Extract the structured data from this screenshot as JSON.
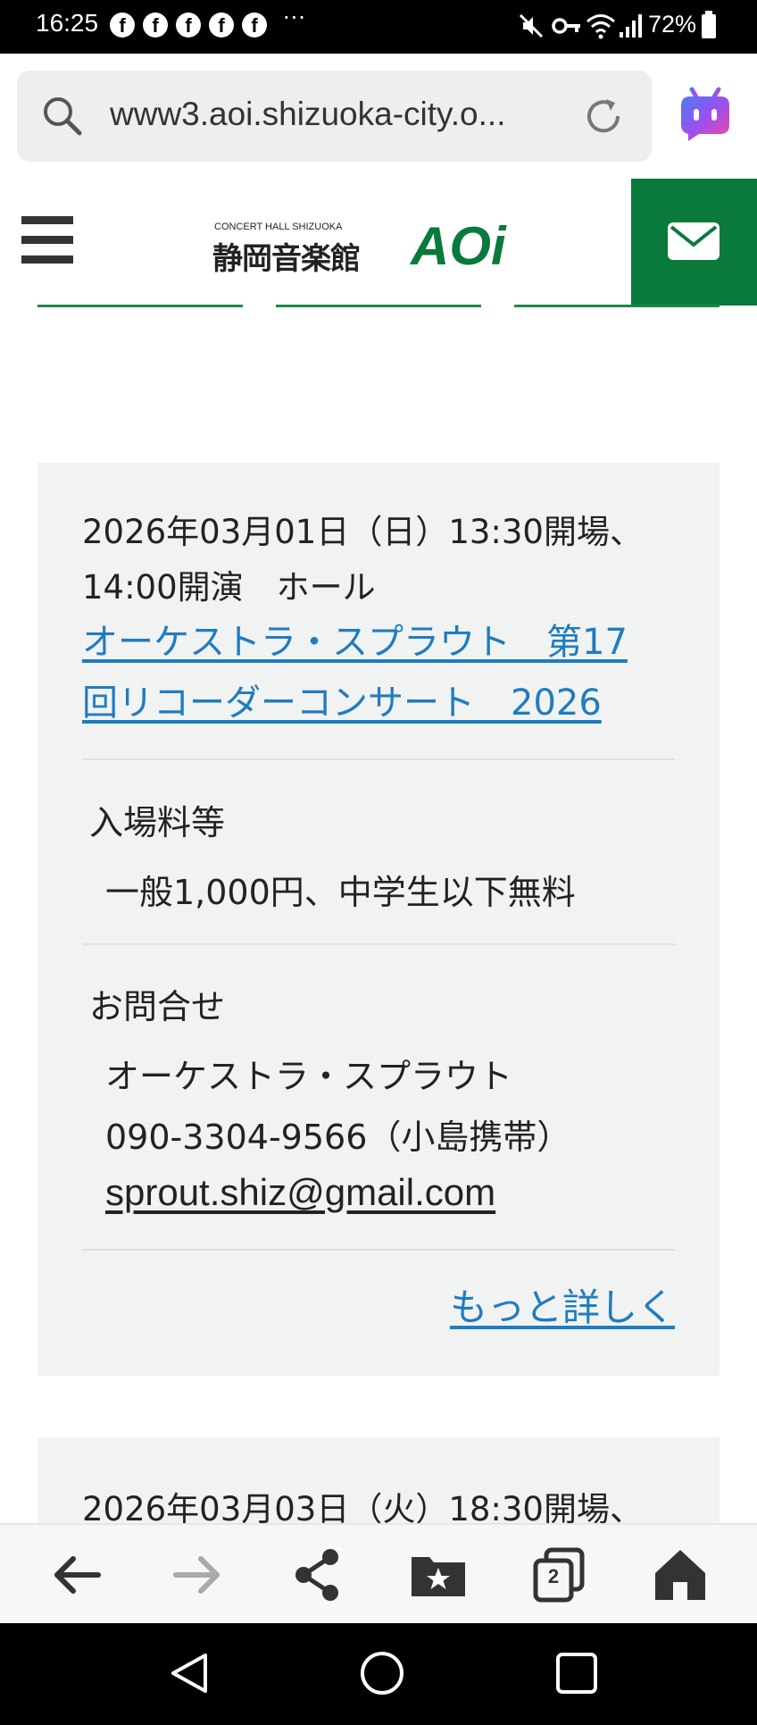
{
  "status_bar": {
    "time": "16:25",
    "notification_icons": [
      "facebook-icon",
      "facebook-icon",
      "facebook-icon",
      "facebook-icon",
      "facebook-icon"
    ],
    "facebook_glyph": "f",
    "more": "···",
    "battery_percent": "72%"
  },
  "browser": {
    "url": "www3.aoi.shizuoka-city.o...",
    "tab_count": "2"
  },
  "site": {
    "logo_small": "CONCERT HALL SHIZUOKA",
    "logo_kanji": "静岡音楽館",
    "logo_aoi": "AOi",
    "brand_color": "#0a7a3c"
  },
  "events": [
    {
      "date_line1": "2026年03月01日（日）13:30開場、",
      "date_line2": "14:00開演　ホール",
      "title_line1": "オーケストラ・スプラウト　第17",
      "title_line2": "回リコーダーコンサート　2026",
      "fee_label": "入場料等",
      "fee_value": "一般1,000円、中学生以下無料",
      "contact_label": "お問合せ",
      "contact_org": "オーケストラ・スプラウト",
      "contact_phone": "090-3304-9566（小島携帯）",
      "contact_email": "sprout.shiz@gmail.com",
      "more_link": "もっと詳しく"
    },
    {
      "date_line1": "2026年03月03日（火）18:30開場、"
    }
  ],
  "colors": {
    "link": "#1f7cbf",
    "card_bg": "#f1f2f2"
  }
}
